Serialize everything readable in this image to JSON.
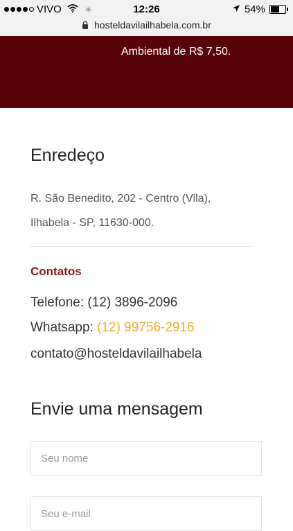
{
  "status_bar": {
    "carrier": "VIVO",
    "time": "12:26",
    "battery": "54%",
    "battery_level": 0.54,
    "icons": [
      "signal-dots-icon",
      "wifi-icon",
      "loading-spinner-icon",
      "location-arrow-icon",
      "battery-icon"
    ]
  },
  "browser": {
    "url": "hosteldavilailhabela.com.br",
    "lock_icon": "lock-icon"
  },
  "banner": {
    "text": "Ambiental de R$ 7,50.",
    "background": "#570207"
  },
  "address": {
    "heading": "Enredeço",
    "line1": "R. São Benedito, 202 - Centro (Vila),",
    "line2": "Ilhabela - SP, 11630-000."
  },
  "contacts": {
    "heading": "Contatos",
    "phone": "Telefone: (12) 3896-2096",
    "whatsapp_label": "Whatsapp: ",
    "whatsapp_number": "(12) 99756-2916",
    "email": "contato@hosteldavilailhabela",
    "accent_color": "#8a1c1c",
    "link_color": "#f0ad2a"
  },
  "form": {
    "heading": "Envie uma mensagem",
    "name_placeholder": "Seu nome",
    "email_placeholder": "Seu e-mail"
  }
}
